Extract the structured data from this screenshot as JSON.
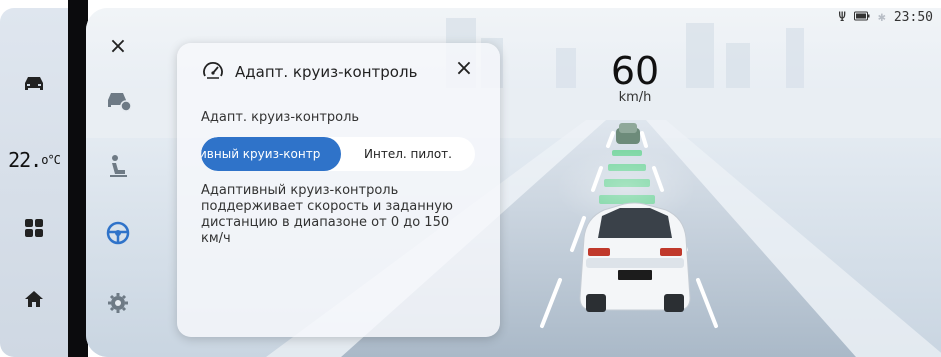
{
  "status": {
    "usb": "Ψ",
    "battery": "▭",
    "bluetooth": "✱",
    "time": "23:50"
  },
  "rail": {
    "items": [
      {
        "name": "car-icon"
      },
      {
        "temperature_value": "22.",
        "temperature_unit": "o°C"
      },
      {
        "name": "apps-grid-icon"
      },
      {
        "name": "home-icon"
      }
    ]
  },
  "icon_col": {
    "close": "×",
    "items": [
      "car-settings-icon",
      "seat-icon",
      "steering-wheel-icon",
      "gear-icon"
    ]
  },
  "dialog": {
    "title": "Адапт. круиз-контроль",
    "close": "×",
    "section_label": "Адапт. круиз-контроль",
    "options": [
      "ивный круиз-контр",
      "Интел. пилот."
    ],
    "description": "Адаптивный круиз-контроль поддерживает скорость и заданную дистанцию в диапазоне от 0 до 150 км/ч"
  },
  "speed": {
    "value": "60",
    "unit": "km/h"
  }
}
